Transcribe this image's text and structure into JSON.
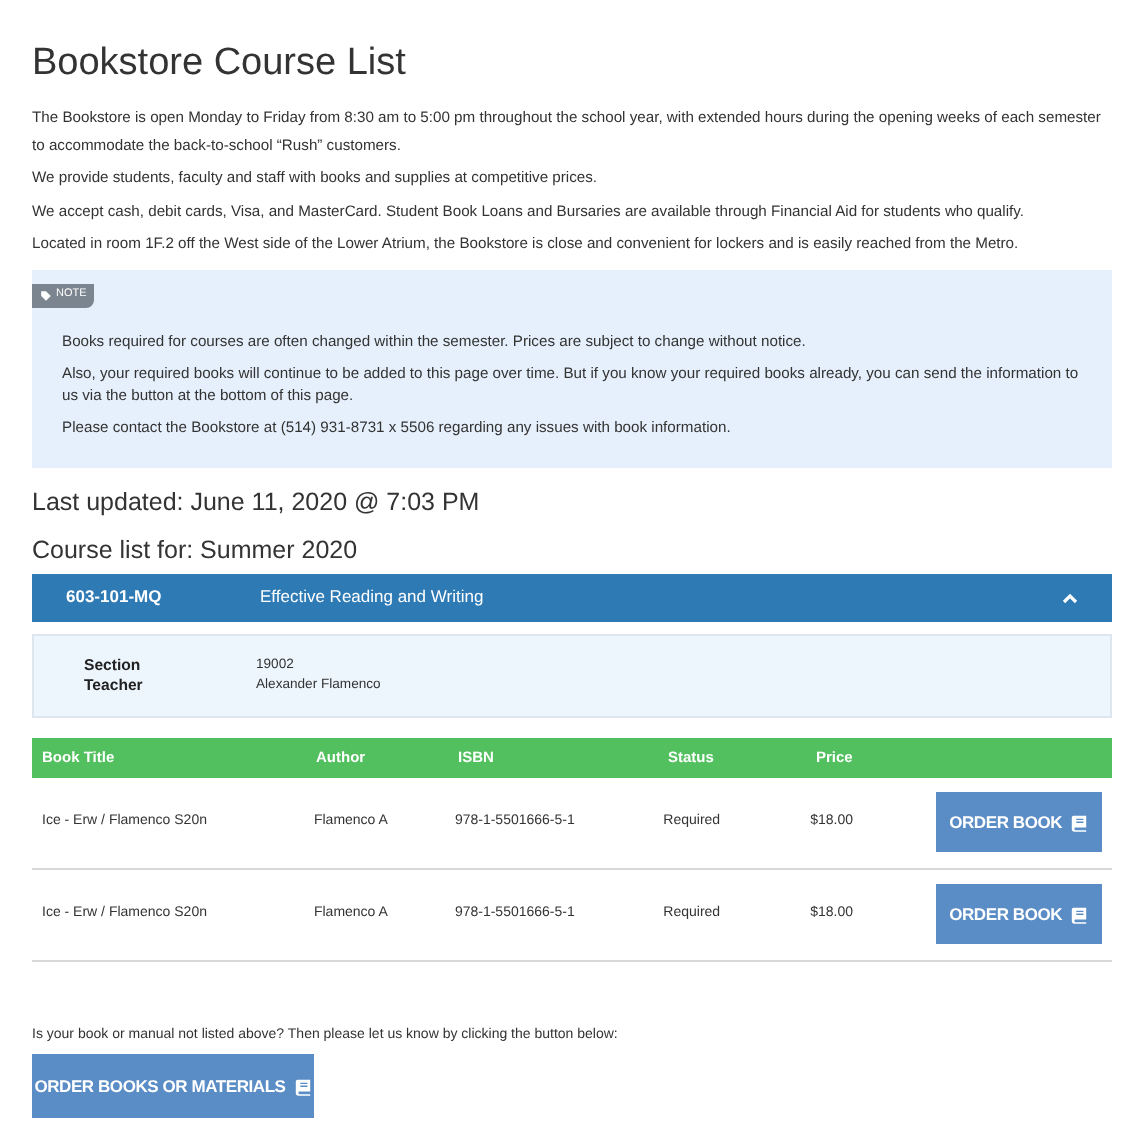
{
  "title": "Bookstore Course List",
  "paragraphs": [
    "The Bookstore is open Monday to Friday from 8:30 am to 5:00 pm throughout the school year, with extended hours during the opening weeks of each semester to accommodate the back-to-school “Rush” customers.",
    "We provide students, faculty and staff with books and supplies at competitive prices.",
    "We accept cash, debit cards, Visa, and MasterCard. Student Book Loans and Bursaries are available through Financial Aid for students who qualify.",
    "Located in room 1F.2 off the West side of the Lower Atrium, the Bookstore is close and convenient for lockers and is easily reached from the Metro."
  ],
  "note": {
    "tag": "NOTE",
    "paragraphs": [
      "Books required for courses are often changed within the semester. Prices are subject to change without notice.",
      "Also, your required books will continue to be added to this page over time. But if you know your required books already, you can send the information to us via the button at the bottom of this page.",
      "Please contact the Bookstore at (514) 931-8731 x 5506 regarding any issues with book information."
    ]
  },
  "last_updated": "Last updated: June 11, 2020 @ 7:03 PM",
  "course_list_for": "Course list for: Summer 2020",
  "course": {
    "code": "603-101-MQ",
    "name": "Effective Reading and Writing",
    "expanded": true,
    "details": [
      {
        "label": "Section",
        "value": "19002"
      },
      {
        "label": "Teacher",
        "value": "Alexander Flamenco"
      }
    ]
  },
  "table": {
    "columns": [
      "Book Title",
      "Author",
      "ISBN",
      "Status",
      "Price"
    ],
    "rows": [
      {
        "cells": [
          "Ice - Erw / Flamenco S20n",
          "Flamenco A",
          "978-1-5501666-5-1",
          "Required",
          "$18.00"
        ],
        "button": "ORDER BOOK"
      },
      {
        "cells": [
          "Ice - Erw / Flamenco S20n",
          "Flamenco A",
          "978-1-5501666-5-1",
          "Required",
          "$18.00"
        ],
        "button": "ORDER BOOK"
      }
    ]
  },
  "footer": {
    "text": "Is your book or manual not listed above? Then please let us know by clicking the button below:",
    "button": "ORDER BOOKS OR MATERIALS"
  }
}
